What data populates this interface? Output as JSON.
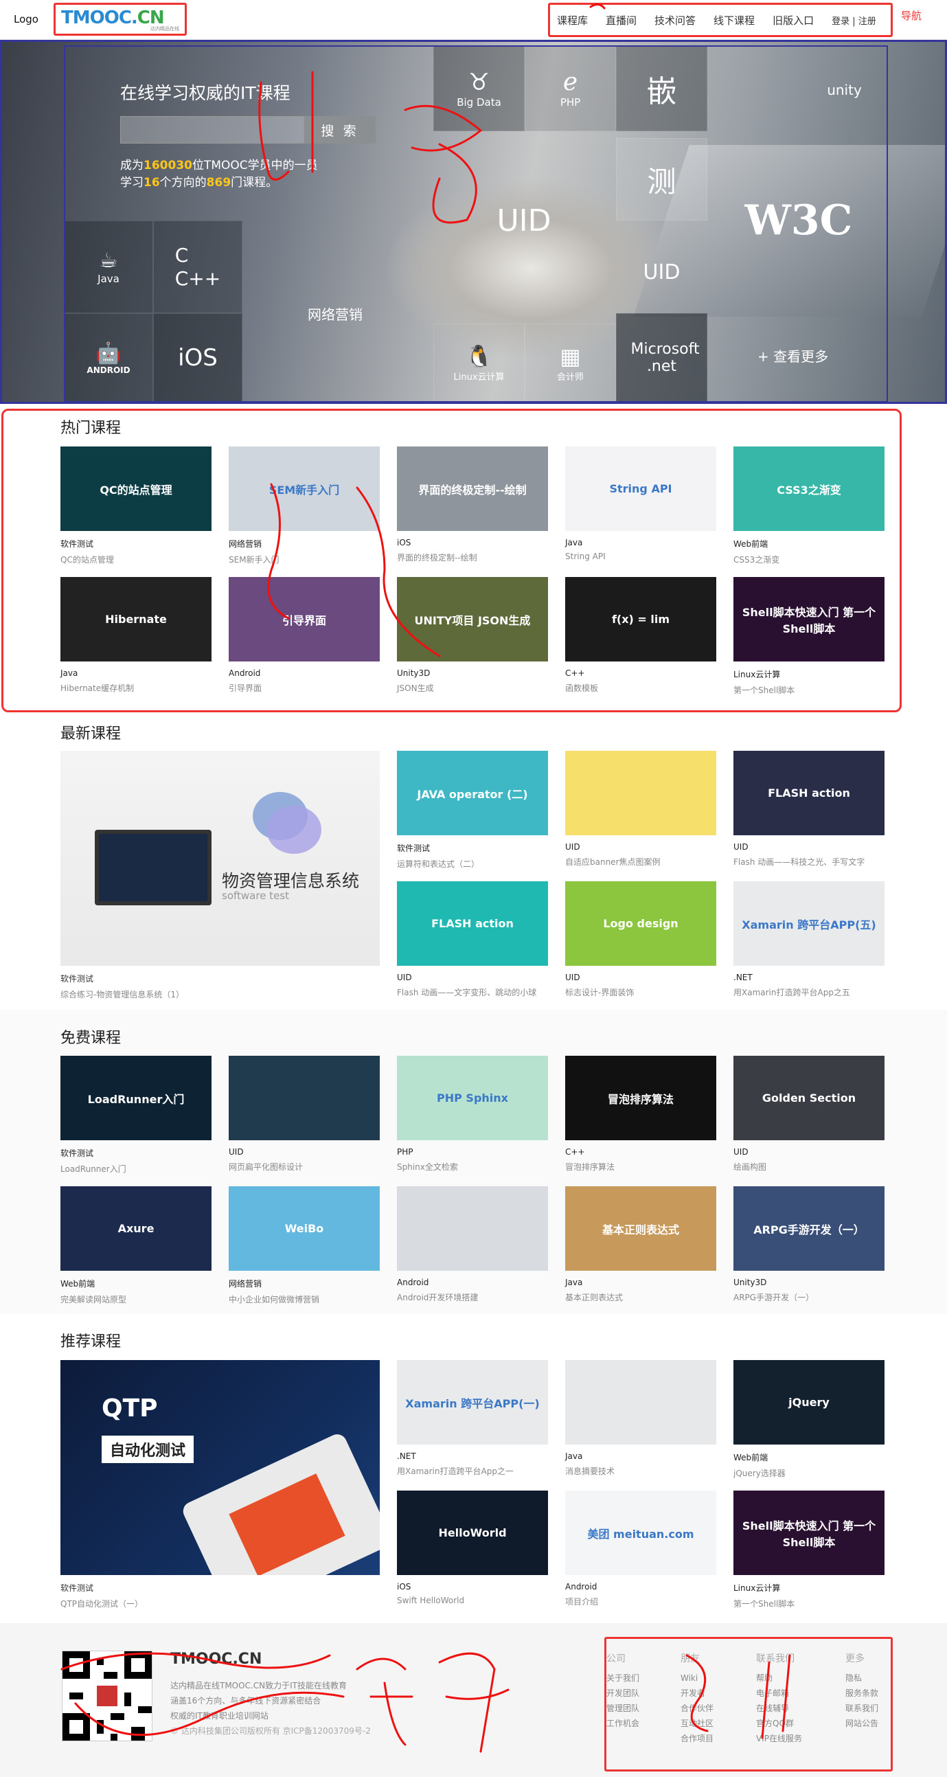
{
  "header": {
    "logo_label": "Logo",
    "brand_main": "TMOOC.",
    "brand_cn": "CN",
    "brand_sub": "达内精品在线",
    "nav": [
      "课程库",
      "直播间",
      "技术问答",
      "线下课程",
      "旧版入口"
    ],
    "login": "登录 | 注册",
    "nav_annotation": "导航"
  },
  "banner": {
    "title": "在线学习权威的IT课程",
    "search_placeholder": "",
    "search_button": "搜 索",
    "stat_line1_pre": "成为",
    "stat_users": "160030",
    "stat_line1_post": "位TMOOC学员中的一员",
    "stat_line2_pre": "学习",
    "stat_directions": "16",
    "stat_line2_mid": "个方向的",
    "stat_courses": "869",
    "stat_line2_post": "门课程。",
    "tiles": [
      "Big Data",
      "PHP",
      "嵌",
      "unity",
      "测",
      "UID",
      "UID",
      "W3C",
      "Java",
      "C\nC++",
      "网络营销",
      "ANDROID",
      "iOS",
      "Linux云计算",
      "会计师",
      "Microsoft .net"
    ],
    "more": "+ 查看更多"
  },
  "hot": {
    "title": "热门课程",
    "cards": [
      {
        "cat": "软件测试",
        "sub": "QC的站点管理",
        "img": "QC的站点管理",
        "color": "#0c3d45"
      },
      {
        "cat": "网络营销",
        "sub": "SEM新手入门",
        "img": "SEM新手入门",
        "color": "#cfd6dd"
      },
      {
        "cat": "iOS",
        "sub": "界面的终极定制--绘制",
        "img": "界面的终极定制--绘制",
        "color": "#8f959c"
      },
      {
        "cat": "Java",
        "sub": "String API",
        "img": "String API",
        "color": "#f3f3f5"
      },
      {
        "cat": "Web前端",
        "sub": "CSS3之渐变",
        "img": "CSS3之渐变",
        "color": "#36b7a8"
      },
      {
        "cat": "Java",
        "sub": "Hibernate缓存机制",
        "img": "Hibernate",
        "color": "#222"
      },
      {
        "cat": "Android",
        "sub": "引导界面",
        "img": "引导界面",
        "color": "#6b4a7f"
      },
      {
        "cat": "Unity3D",
        "sub": "JSON生成",
        "img": "UNITY项目 JSON生成",
        "color": "#5f6a3a"
      },
      {
        "cat": "C++",
        "sub": "函数模板",
        "img": "f(x) = lim",
        "color": "#1b1b1b"
      },
      {
        "cat": "Linux云计算",
        "sub": "第一个Shell脚本",
        "img": "Shell脚本快速入门 第一个Shell脚本",
        "color": "#2a1030"
      }
    ]
  },
  "latest": {
    "title": "最新课程",
    "big": {
      "cat": "软件测试",
      "sub": "综合练习-物资管理信息系统（1）",
      "img_title": "物资管理信息系统",
      "img_sub": "software test"
    },
    "cards": [
      {
        "cat": "软件测试",
        "sub": "运算符和表达式（二）",
        "img": "JAVA operator (二)",
        "color": "#3fb8c6"
      },
      {
        "cat": "UID",
        "sub": "自适应banner焦点图案例",
        "img": "",
        "color": "#f7df6b"
      },
      {
        "cat": "UID",
        "sub": "Flash 动画——科技之光、手写文字",
        "img": "FLASH action",
        "color": "#2a2d48"
      },
      {
        "cat": "UID",
        "sub": "Flash 动画——文字变形、跳动的小球",
        "img": "FLASH action",
        "color": "#1fb9b2"
      },
      {
        "cat": "UID",
        "sub": "标志设计-界面装饰",
        "img": "Logo design",
        "color": "#8cc63f"
      },
      {
        "cat": ".NET",
        "sub": "用Xamarin打造跨平台App之五",
        "img": "Xamarin 跨平台APP(五)",
        "color": "#e9eaec"
      }
    ]
  },
  "free": {
    "title": "免费课程",
    "cards": [
      {
        "cat": "软件测试",
        "sub": "LoadRunner入门",
        "img": "LoadRunner入门",
        "color": "#0d2233"
      },
      {
        "cat": "UID",
        "sub": "网页扁平化图标设计",
        "img": "",
        "color": "#1f3b4d"
      },
      {
        "cat": "PHP",
        "sub": "Sphinx全文检索",
        "img": "PHP Sphinx",
        "color": "#b7e2cf"
      },
      {
        "cat": "C++",
        "sub": "冒泡排序算法",
        "img": "冒泡排序算法",
        "color": "#111"
      },
      {
        "cat": "UID",
        "sub": "绘画构图",
        "img": "Golden Section",
        "color": "#3a3d44"
      },
      {
        "cat": "Web前端",
        "sub": "完美解读网站原型",
        "img": "Axure",
        "color": "#1b2a4d"
      },
      {
        "cat": "网络营销",
        "sub": "中小企业如何做微博营销",
        "img": "WeiBo",
        "color": "#63b8e0"
      },
      {
        "cat": "Android",
        "sub": "Android开发环境搭建",
        "img": "",
        "color": "#d8dbe0"
      },
      {
        "cat": "Java",
        "sub": "基本正则表达式",
        "img": "基本正则表达式",
        "color": "#c79a5b"
      },
      {
        "cat": "Unity3D",
        "sub": "ARPG手游开发（一）",
        "img": "ARPG手游开发（一）",
        "color": "#3a4f78"
      }
    ]
  },
  "recommend": {
    "title": "推荐课程",
    "big": {
      "cat": "软件测试",
      "sub": "QTP自动化测试（一）",
      "img_title": "QTP",
      "img_sub": "自动化测试"
    },
    "cards": [
      {
        "cat": ".NET",
        "sub": "用Xamarin打造跨平台App之一",
        "img": "Xamarin 跨平台APP(一)",
        "color": "#e9eaec"
      },
      {
        "cat": "Java",
        "sub": "消息摘要技术",
        "img": "",
        "color": "#e6e8ea"
      },
      {
        "cat": "Web前端",
        "sub": "jQuery选择器",
        "img": "jQuery",
        "color": "#13212e"
      },
      {
        "cat": "iOS",
        "sub": "Swift HelloWorld",
        "img": "HelloWorld",
        "color": "#0f1b2b"
      },
      {
        "cat": "Android",
        "sub": "项目介绍",
        "img": "美团 meituan.com",
        "color": "#f4f5f6"
      },
      {
        "cat": "Linux云计算",
        "sub": "第一个Shell脚本",
        "img": "Shell脚本快速入门 第一个Shell脚本",
        "color": "#2a1030"
      }
    ]
  },
  "footer": {
    "brand": "TMOOC.CN",
    "desc": [
      "达内精品在线TMOOC.CN致力于IT技能在线教育",
      "涵盖16个方向、与多年线下资源紧密结合",
      "权威的IT教育职业培训网站"
    ],
    "copyright": "© 达内科技集团公司版权所有 京ICP备12003709号-2",
    "cols": [
      {
        "h": "公司",
        "items": [
          "关于我们",
          "开发团队",
          "管理团队",
          "工作机会"
        ]
      },
      {
        "h": "朋友",
        "items": [
          "Wiki",
          "开发者",
          "合作伙伴",
          "互动社区",
          "合作项目"
        ]
      },
      {
        "h": "联系我们",
        "items": [
          "帮助",
          "电子邮箱",
          "在线辅导",
          "官方QQ群",
          "VIP在线服务"
        ]
      },
      {
        "h": "更多",
        "items": [
          "隐私",
          "服务条款",
          "联系我们",
          "网站公告"
        ]
      }
    ]
  }
}
